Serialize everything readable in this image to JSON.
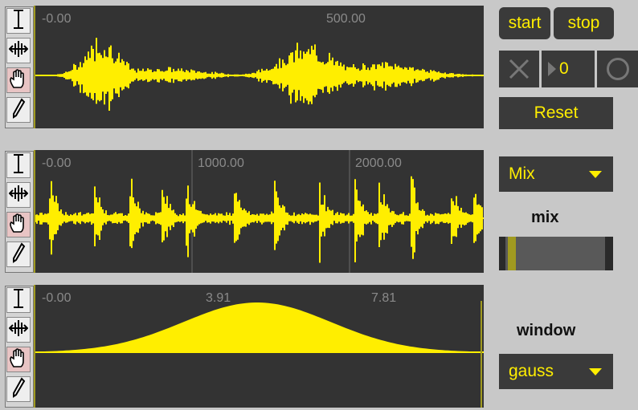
{
  "colors": {
    "background": "#c8c8c8",
    "panel": "#333333",
    "wave": "#ffee00",
    "control": "#3a3a3a"
  },
  "tool_icons": [
    "ibeam-select-icon",
    "move-icon",
    "hand-icon",
    "pencil-icon"
  ],
  "waveforms": [
    {
      "name": "waveform-1",
      "ticks": [
        "-0.00",
        "500.00"
      ],
      "gridlines": false
    },
    {
      "name": "waveform-2",
      "ticks": [
        "-0.00",
        "1000.00",
        "2000.00"
      ],
      "gridlines": true
    },
    {
      "name": "window-waveform",
      "ticks": [
        "-0.00",
        "3.91",
        "7.81"
      ],
      "gridlines": false
    }
  ],
  "transport": {
    "start": "start",
    "stop": "stop",
    "counter": "0",
    "reset": "Reset"
  },
  "mix_menu": {
    "selected": "Mix"
  },
  "mix_label": "mix",
  "mix_slider": {
    "value": 0.03
  },
  "window_label": "window",
  "window_menu": {
    "selected": "gauss"
  }
}
